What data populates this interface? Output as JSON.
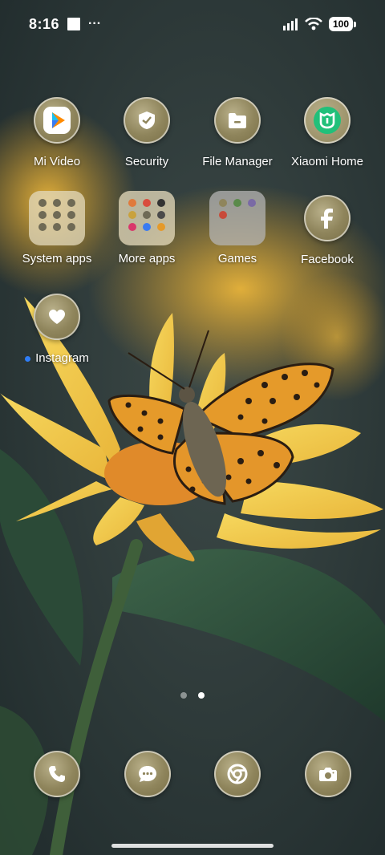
{
  "status_bar": {
    "time": "8:16",
    "overflow": "···",
    "battery": "100",
    "icons": [
      "signal-icon",
      "wifi-icon",
      "battery-icon"
    ]
  },
  "apps": {
    "mi_video": "Mi Video",
    "security": "Security",
    "file_manager": "File Manager",
    "xiaomi_home": "Xiaomi Home",
    "system_apps": "System apps",
    "more_apps": "More apps",
    "games": "Games",
    "facebook": "Facebook",
    "instagram": "Instagram"
  },
  "page_indicator": {
    "total": 2,
    "current": 2
  },
  "dock": [
    "phone-icon",
    "messages-icon",
    "chrome-icon",
    "camera-icon"
  ],
  "colors": {
    "icon_tint": "#8f855c",
    "notification_dot": "#2f7df6",
    "xiaomi_home_green": "#21c07a"
  }
}
